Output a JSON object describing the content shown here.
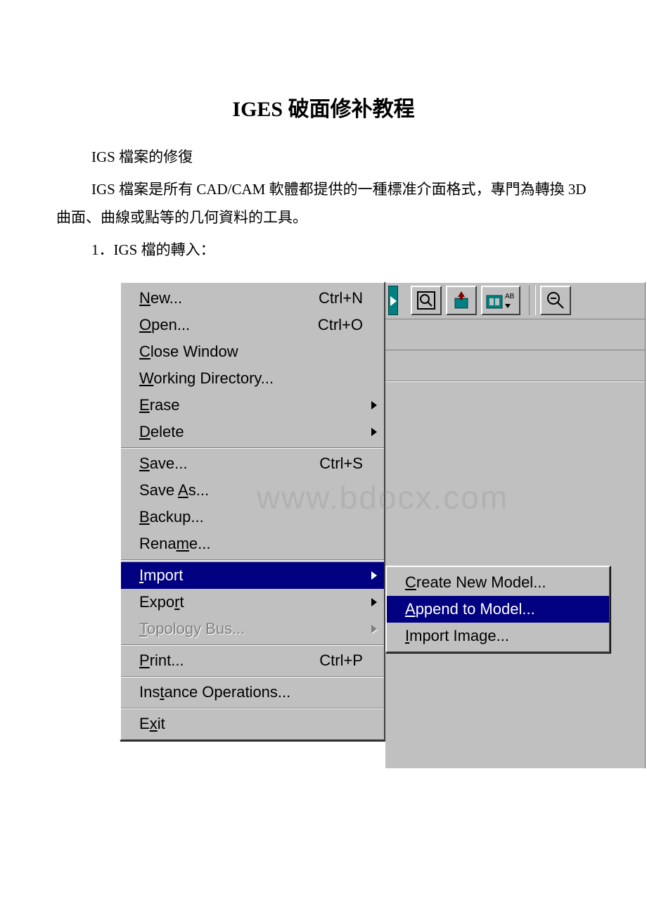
{
  "title": "IGES 破面修补教程",
  "paragraphs": {
    "p1": "IGS 檔案的修復",
    "p2": "IGS 檔案是所有 CAD/CAM 軟體都提供的一種標准介面格式，專門為轉換 3D 曲面、曲線或點等的几何資料的工具。",
    "p3": "1．IGS 檔的轉入："
  },
  "watermark": "www.bdocx.com",
  "menu": {
    "group1": [
      {
        "u": "N",
        "rest": "ew...",
        "shortcut": "Ctrl+N",
        "arrow": false
      },
      {
        "u": "O",
        "rest": "pen...",
        "shortcut": "Ctrl+O",
        "arrow": false
      },
      {
        "u": "C",
        "rest": "lose Window",
        "shortcut": "",
        "arrow": false
      },
      {
        "u": "W",
        "rest": "orking Directory...",
        "shortcut": "",
        "arrow": false
      },
      {
        "u": "E",
        "rest": "rase",
        "shortcut": "",
        "arrow": true
      },
      {
        "u": "D",
        "rest": "elete",
        "shortcut": "",
        "arrow": true
      }
    ],
    "group2": [
      {
        "u": "S",
        "rest": "ave...",
        "shortcut": "Ctrl+S",
        "arrow": false
      },
      {
        "pre": "Save ",
        "u": "A",
        "rest": "s...",
        "shortcut": "",
        "arrow": false
      },
      {
        "u": "B",
        "rest": "ackup...",
        "shortcut": "",
        "arrow": false
      },
      {
        "pre": "Rena",
        "u": "m",
        "rest": "e...",
        "shortcut": "",
        "arrow": false
      }
    ],
    "group3": [
      {
        "u": "I",
        "rest": "mport",
        "shortcut": "",
        "arrow": true,
        "highlight": true
      },
      {
        "pre": "Expo",
        "u": "r",
        "rest": "t",
        "shortcut": "",
        "arrow": true
      },
      {
        "u": "T",
        "rest": "opology Bus...",
        "shortcut": "",
        "arrow": true,
        "disabled": true
      }
    ],
    "group4": [
      {
        "u": "P",
        "rest": "rint...",
        "shortcut": "Ctrl+P",
        "arrow": false
      }
    ],
    "group5": [
      {
        "pre": "Ins",
        "u": "t",
        "rest": "ance Operations...",
        "shortcut": "",
        "arrow": false
      }
    ],
    "group6": [
      {
        "pre": "E",
        "u": "x",
        "rest": "it",
        "shortcut": "",
        "arrow": false
      }
    ]
  },
  "submenu": [
    {
      "u": "C",
      "rest": "reate New Model..."
    },
    {
      "u": "A",
      "rest": "ppend to Model...",
      "highlight": true
    },
    {
      "u": "I",
      "rest": "mport Image..."
    }
  ],
  "toolbar": {
    "icons": [
      "magnify-box-icon",
      "refit-icon",
      "repaint-ab-icon",
      "zoom-out-icon"
    ]
  }
}
